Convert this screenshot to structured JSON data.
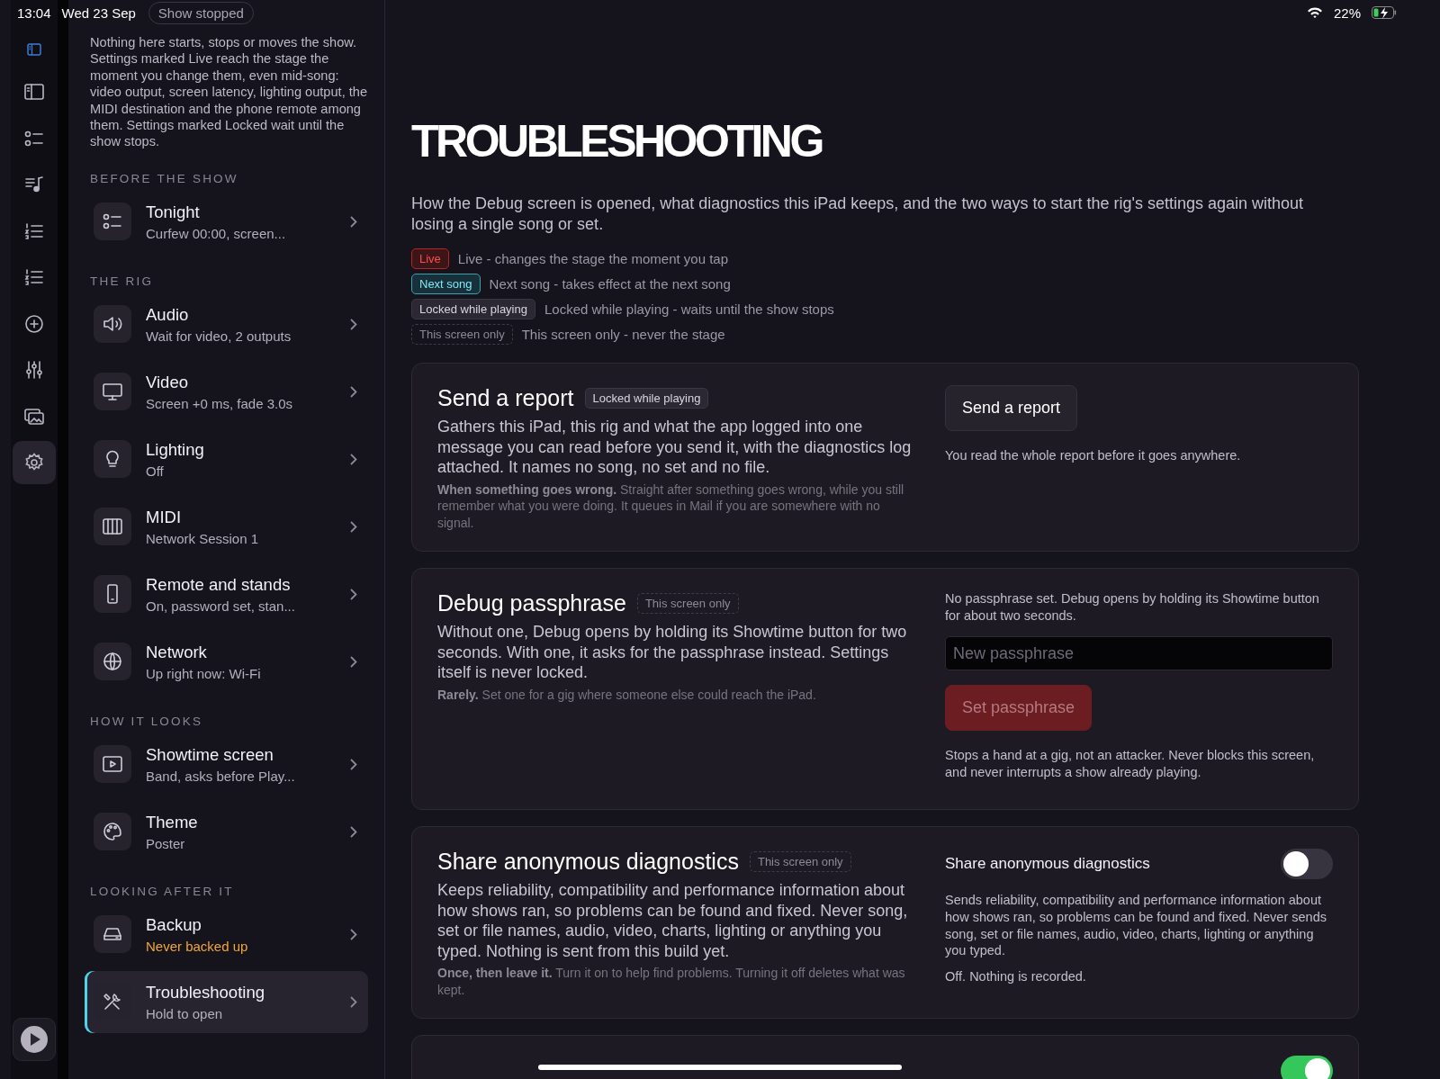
{
  "status_bar": {
    "time": "13:04",
    "date": "Wed 23 Sep",
    "battery": "22%",
    "charging": true
  },
  "show_status": "Show stopped",
  "rail": {
    "items": [
      {
        "selected": false
      },
      {
        "selected": false
      },
      {
        "selected": false
      },
      {
        "selected": false
      },
      {
        "selected": false
      },
      {
        "selected": false
      },
      {
        "selected": false
      },
      {
        "selected": false
      },
      {
        "selected": true
      }
    ]
  },
  "sidebar": {
    "intro": "Nothing here starts, stops or moves the show. Settings marked Live reach the stage the moment you change them, even mid-song: video output, screen latency, lighting output, the MIDI destination and the phone remote among them. Settings marked Locked wait until the show stops.",
    "groups": [
      {
        "heading": "BEFORE THE SHOW",
        "items": [
          {
            "title": "Tonight",
            "subtitle": "Curfew 00:00, screen...",
            "kind": "normal",
            "selected": false
          }
        ]
      },
      {
        "heading": "THE RIG",
        "items": [
          {
            "title": "Audio",
            "subtitle": "Wait for video, 2 outputs",
            "kind": "normal",
            "selected": false
          },
          {
            "title": "Video",
            "subtitle": "Screen +0 ms, fade 3.0s",
            "kind": "normal",
            "selected": false
          },
          {
            "title": "Lighting",
            "subtitle": "Off",
            "kind": "normal",
            "selected": false
          },
          {
            "title": "MIDI",
            "subtitle": "Network Session 1",
            "kind": "normal",
            "selected": false
          },
          {
            "title": "Remote and stands",
            "subtitle": "On, password set, stan...",
            "kind": "normal",
            "selected": false
          },
          {
            "title": "Network",
            "subtitle": "Up right now: Wi-Fi",
            "kind": "normal",
            "selected": false
          }
        ]
      },
      {
        "heading": "HOW IT LOOKS",
        "items": [
          {
            "title": "Showtime screen",
            "subtitle": "Band, asks before Play...",
            "kind": "normal",
            "selected": false
          },
          {
            "title": "Theme",
            "subtitle": "Poster",
            "kind": "normal",
            "selected": false
          }
        ]
      },
      {
        "heading": "LOOKING AFTER IT",
        "items": [
          {
            "title": "Backup",
            "subtitle": "Never backed up",
            "kind": "warning",
            "selected": false
          },
          {
            "title": "Troubleshooting",
            "subtitle": "Hold to open",
            "kind": "normal",
            "selected": true
          }
        ]
      }
    ]
  },
  "main": {
    "title": "TROUBLESHOOTING",
    "intro": "How the Debug screen is opened, what diagnostics this iPad keeps, and the two ways to start the rig's settings again without losing a single song or set.",
    "legend": [
      {
        "kind": "live",
        "badge": "Live",
        "text": "Live - changes the stage the moment you tap"
      },
      {
        "kind": "next",
        "badge": "Next song",
        "text": "Next song - takes effect at the next song"
      },
      {
        "kind": "locked",
        "badge": "Locked while playing",
        "text": "Locked while playing - waits until the show stops"
      },
      {
        "kind": "screen",
        "badge": "This screen only",
        "text": "This screen only - never the stage"
      }
    ],
    "cards": [
      {
        "kind": "report",
        "title": "Send a report",
        "badge": {
          "kind": "locked",
          "label": "Locked while playing"
        },
        "body": "Gathers this iPad, this rig and what the app logged into one message you can read before you send it, with the diagnostics log attached. It names no song, no set and no file.",
        "note_lead": "When something goes wrong.",
        "note": "Straight after something goes wrong, while you still remember what you were doing. It queues in Mail if you are somewhere with no signal.",
        "button": "Send a report",
        "caption": "You read the whole report before it goes anywhere."
      },
      {
        "kind": "passphrase",
        "title": "Debug passphrase",
        "badge": {
          "kind": "screen",
          "label": "This screen only"
        },
        "body": "Without one, Debug opens by holding its Showtime button for two seconds. With one, it asks for the passphrase instead. Settings itself is never locked.",
        "note_lead": "Rarely.",
        "note": "Set one for a gig where someone else could reach the iPad.",
        "status": "No passphrase set. Debug opens by holding its Showtime button for about two seconds.",
        "placeholder": "New passphrase",
        "button": "Set passphrase",
        "disabled": true,
        "caption": "Stops a hand at a gig, not an attacker. Never blocks this screen, and never interrupts a show already playing."
      },
      {
        "kind": "toggle",
        "title": "Share anonymous diagnostics",
        "badge": {
          "kind": "screen",
          "label": "This screen only"
        },
        "body": "Keeps reliability, compatibility and performance information about how shows ran, so problems can be found and fixed. Never song, set or file names, audio, video, charts, lighting or anything you typed. Nothing is sent from this build yet.",
        "note_lead": "Once, then leave it.",
        "note": "Turn it on to help find problems. Turning it off deletes what was kept.",
        "toggle_label": "Share anonymous diagnostics",
        "on": false,
        "description": "Sends reliability, compatibility and performance information about how shows ran, so problems can be found and fixed. Never sends song, set or file names, audio, video, charts, lighting or anything you typed.",
        "status": "Off. Nothing is recorded."
      },
      {
        "kind": "partial",
        "on": true
      }
    ]
  }
}
